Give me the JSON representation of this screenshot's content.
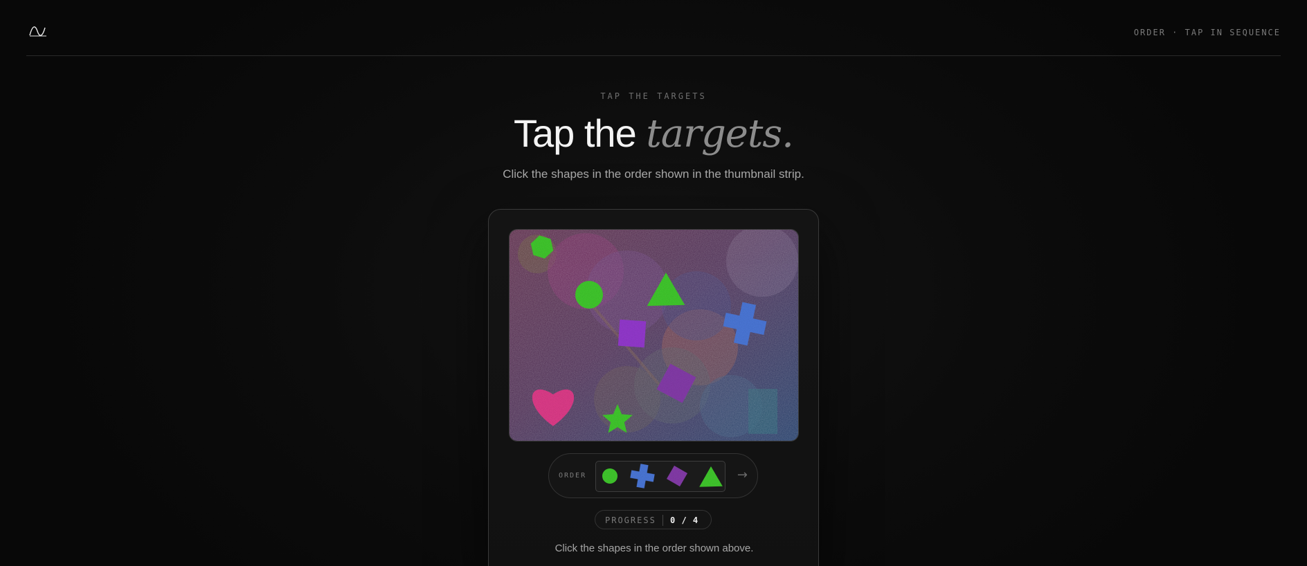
{
  "header": {
    "logo_icon": "wave-logo-icon",
    "status": "ORDER · TAP IN SEQUENCE"
  },
  "hero": {
    "eyebrow": "TAP THE TARGETS",
    "title_plain": "Tap the ",
    "title_emphasis": "targets.",
    "subtitle": "Click the shapes in the order shown in the thumbnail strip."
  },
  "canvas": {
    "shapes": [
      {
        "name": "green-hexagon-target",
        "kind": "hexagon",
        "color": "#44d030"
      },
      {
        "name": "green-circle-target",
        "kind": "circle",
        "color": "#44d030"
      },
      {
        "name": "green-triangle-target",
        "kind": "triangle",
        "color": "#44d030"
      },
      {
        "name": "purple-square-target",
        "kind": "square",
        "color": "#9a3ed6"
      },
      {
        "name": "blue-cross-target",
        "kind": "cross",
        "color": "#4f7de0"
      },
      {
        "name": "purple-diamond-target",
        "kind": "diamond",
        "color": "#8a3fb0"
      },
      {
        "name": "pink-heart-target",
        "kind": "heart",
        "color": "#e6418f"
      },
      {
        "name": "green-star-target",
        "kind": "star",
        "color": "#44d030"
      }
    ]
  },
  "order": {
    "label": "ORDER",
    "sequence": [
      {
        "name": "circle-thumbnail",
        "kind": "circle",
        "color": "#44d030"
      },
      {
        "name": "cross-thumbnail",
        "kind": "cross",
        "color": "#4f7de0"
      },
      {
        "name": "diamond-thumbnail",
        "kind": "diamond",
        "color": "#8a3fb0"
      },
      {
        "name": "triangle-thumbnail",
        "kind": "triangle",
        "color": "#44d030"
      }
    ],
    "arrow": "→"
  },
  "progress": {
    "label": "PROGRESS",
    "value": "0 / 4"
  },
  "hint": "Click the shapes in the order shown above."
}
